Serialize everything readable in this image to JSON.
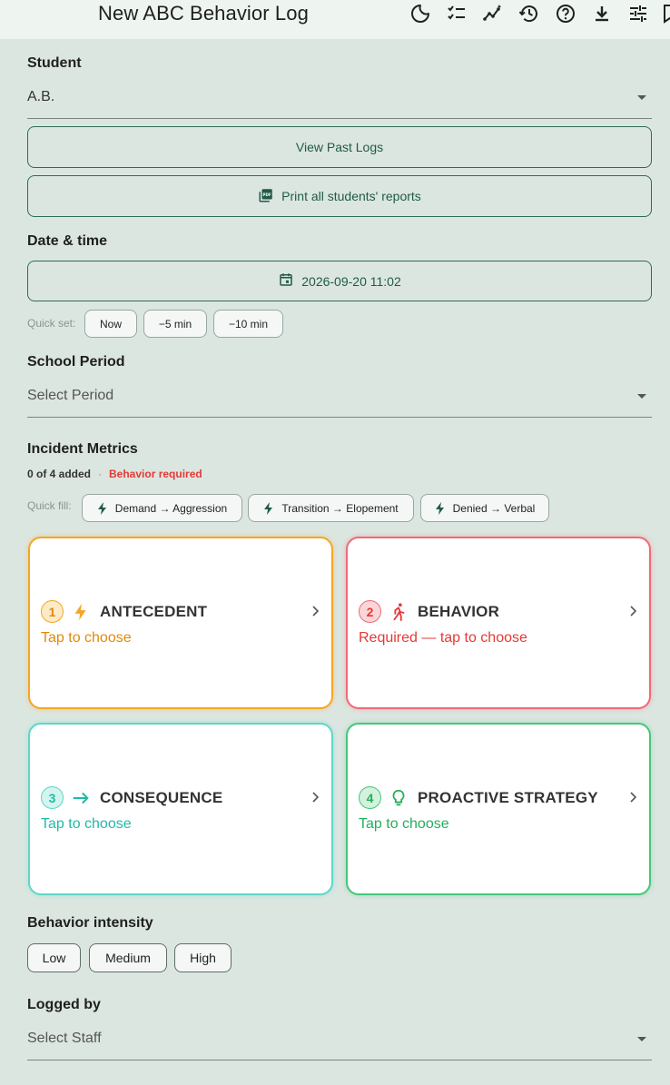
{
  "appbar": {
    "title": "New ABC Behavior Log",
    "icons": [
      "dark-mode-icon",
      "checklist-icon",
      "insights-icon",
      "history-icon",
      "help-icon",
      "download-icon",
      "tune-icon",
      "bookmark-icon"
    ]
  },
  "student": {
    "label": "Student",
    "value": "A.B."
  },
  "buttons": {
    "view_past_logs": "View Past Logs",
    "print_reports": "Print all students' reports"
  },
  "datetime": {
    "label": "Date & time",
    "value": "2026-09-20 11:02",
    "quick_set_label": "Quick set:",
    "quick_set": [
      "Now",
      "−5 min",
      "−10 min"
    ]
  },
  "period": {
    "label": "School Period",
    "placeholder": "Select Period"
  },
  "metrics": {
    "label": "Incident Metrics",
    "count": "0 of 4 added",
    "dot": "·",
    "required": "Behavior required",
    "quick_fill_label": "Quick fill:",
    "quick_fill": [
      "Demand → Aggression",
      "Transition → Elopement",
      "Denied → Verbal"
    ]
  },
  "cards": [
    {
      "num": "1",
      "title": "ANTECEDENT",
      "sub": "Tap to choose",
      "color": "#f5a623",
      "text_color": "#e08a0b",
      "num_bg": "#fdebc8"
    },
    {
      "num": "2",
      "title": "BEHAVIOR",
      "sub": "Required — tap to choose",
      "color": "#ef6b73",
      "text_color": "#e53935",
      "num_bg": "#fbd6d8"
    },
    {
      "num": "3",
      "title": "CONSEQUENCE",
      "sub": "Tap to choose",
      "color": "#5fd6c8",
      "text_color": "#1fbba6",
      "num_bg": "#d4f4ef"
    },
    {
      "num": "4",
      "title": "PROACTIVE STRATEGY",
      "sub": "Tap to choose",
      "color": "#45c77a",
      "text_color": "#22b05a",
      "num_bg": "#d3f1dd"
    }
  ],
  "intensity": {
    "label": "Behavior intensity",
    "options": [
      "Low",
      "Medium",
      "High"
    ]
  },
  "logged_by": {
    "label": "Logged by",
    "placeholder": "Select Staff"
  }
}
